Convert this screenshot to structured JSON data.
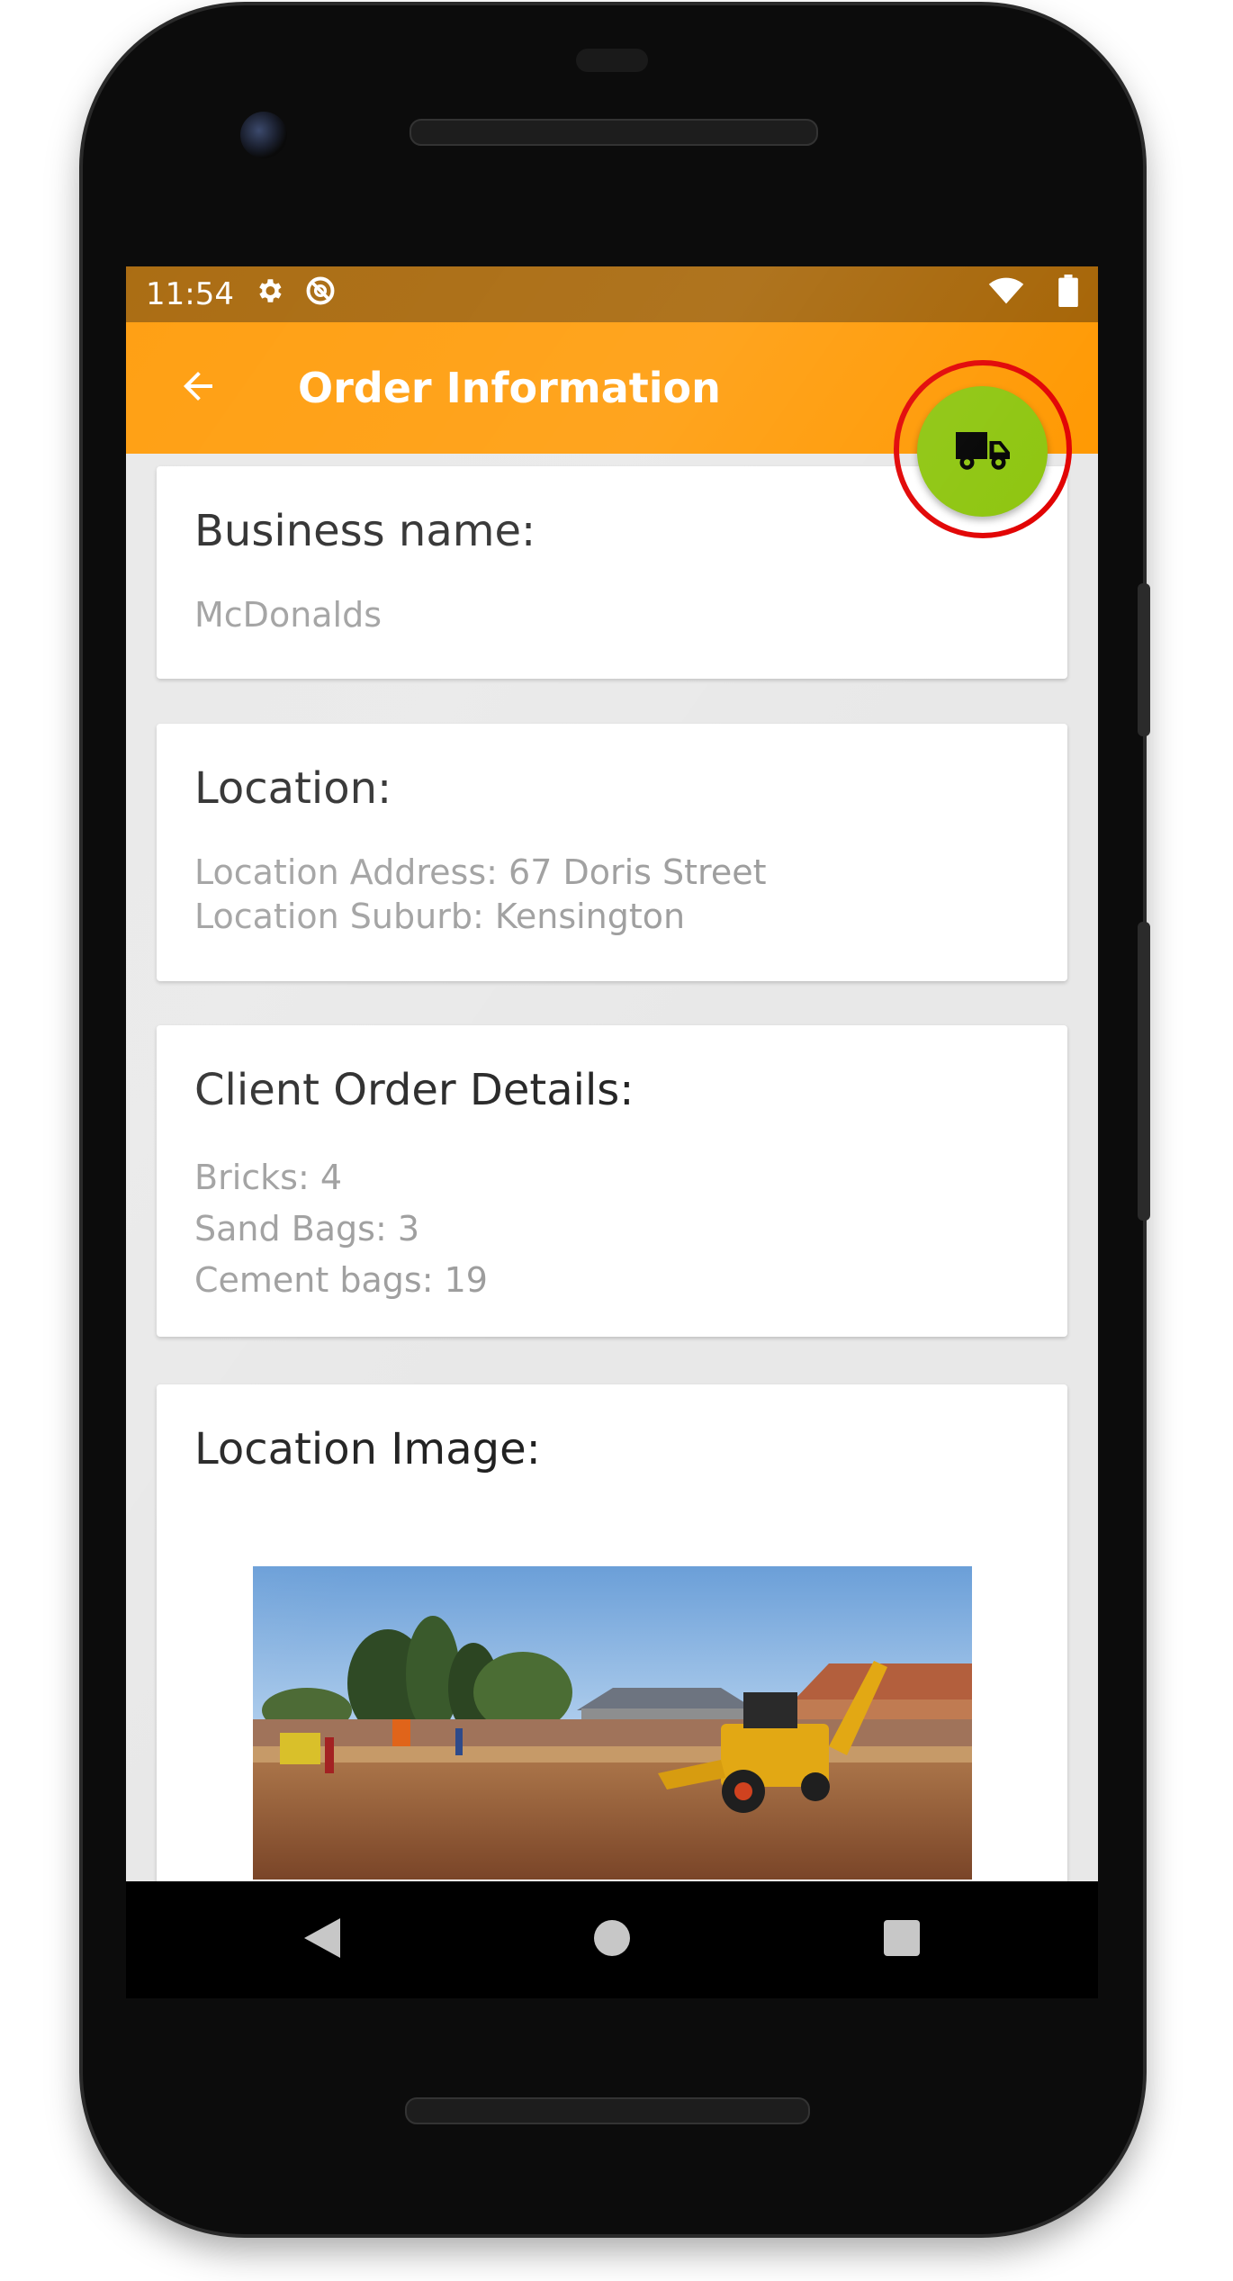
{
  "status_bar": {
    "time": "11:54",
    "icons": [
      "gear-icon",
      "do-not-disturb-icon",
      "wifi-icon",
      "battery-icon"
    ]
  },
  "app_bar": {
    "title": "Order Information",
    "back_icon": "arrow-back-icon",
    "background": "#ff9800"
  },
  "fab": {
    "icon": "truck-icon",
    "color": "#8dc50d",
    "highlight_ring_color": "#e10000"
  },
  "cards": {
    "business": {
      "heading": "Business name:",
      "value": "McDonalds"
    },
    "location": {
      "heading": "Location:",
      "address": "Location Address: 67 Doris Street",
      "suburb": "Location Suburb: Kensington"
    },
    "order": {
      "heading": "Client Order Details:",
      "items": [
        "Bricks: 4",
        "Sand Bags: 3",
        "Cement bags: 19"
      ]
    },
    "image": {
      "heading": "Location Image:"
    }
  },
  "nav_bar": {
    "icons": [
      "back-triangle-icon",
      "home-circle-icon",
      "recents-square-icon"
    ]
  }
}
